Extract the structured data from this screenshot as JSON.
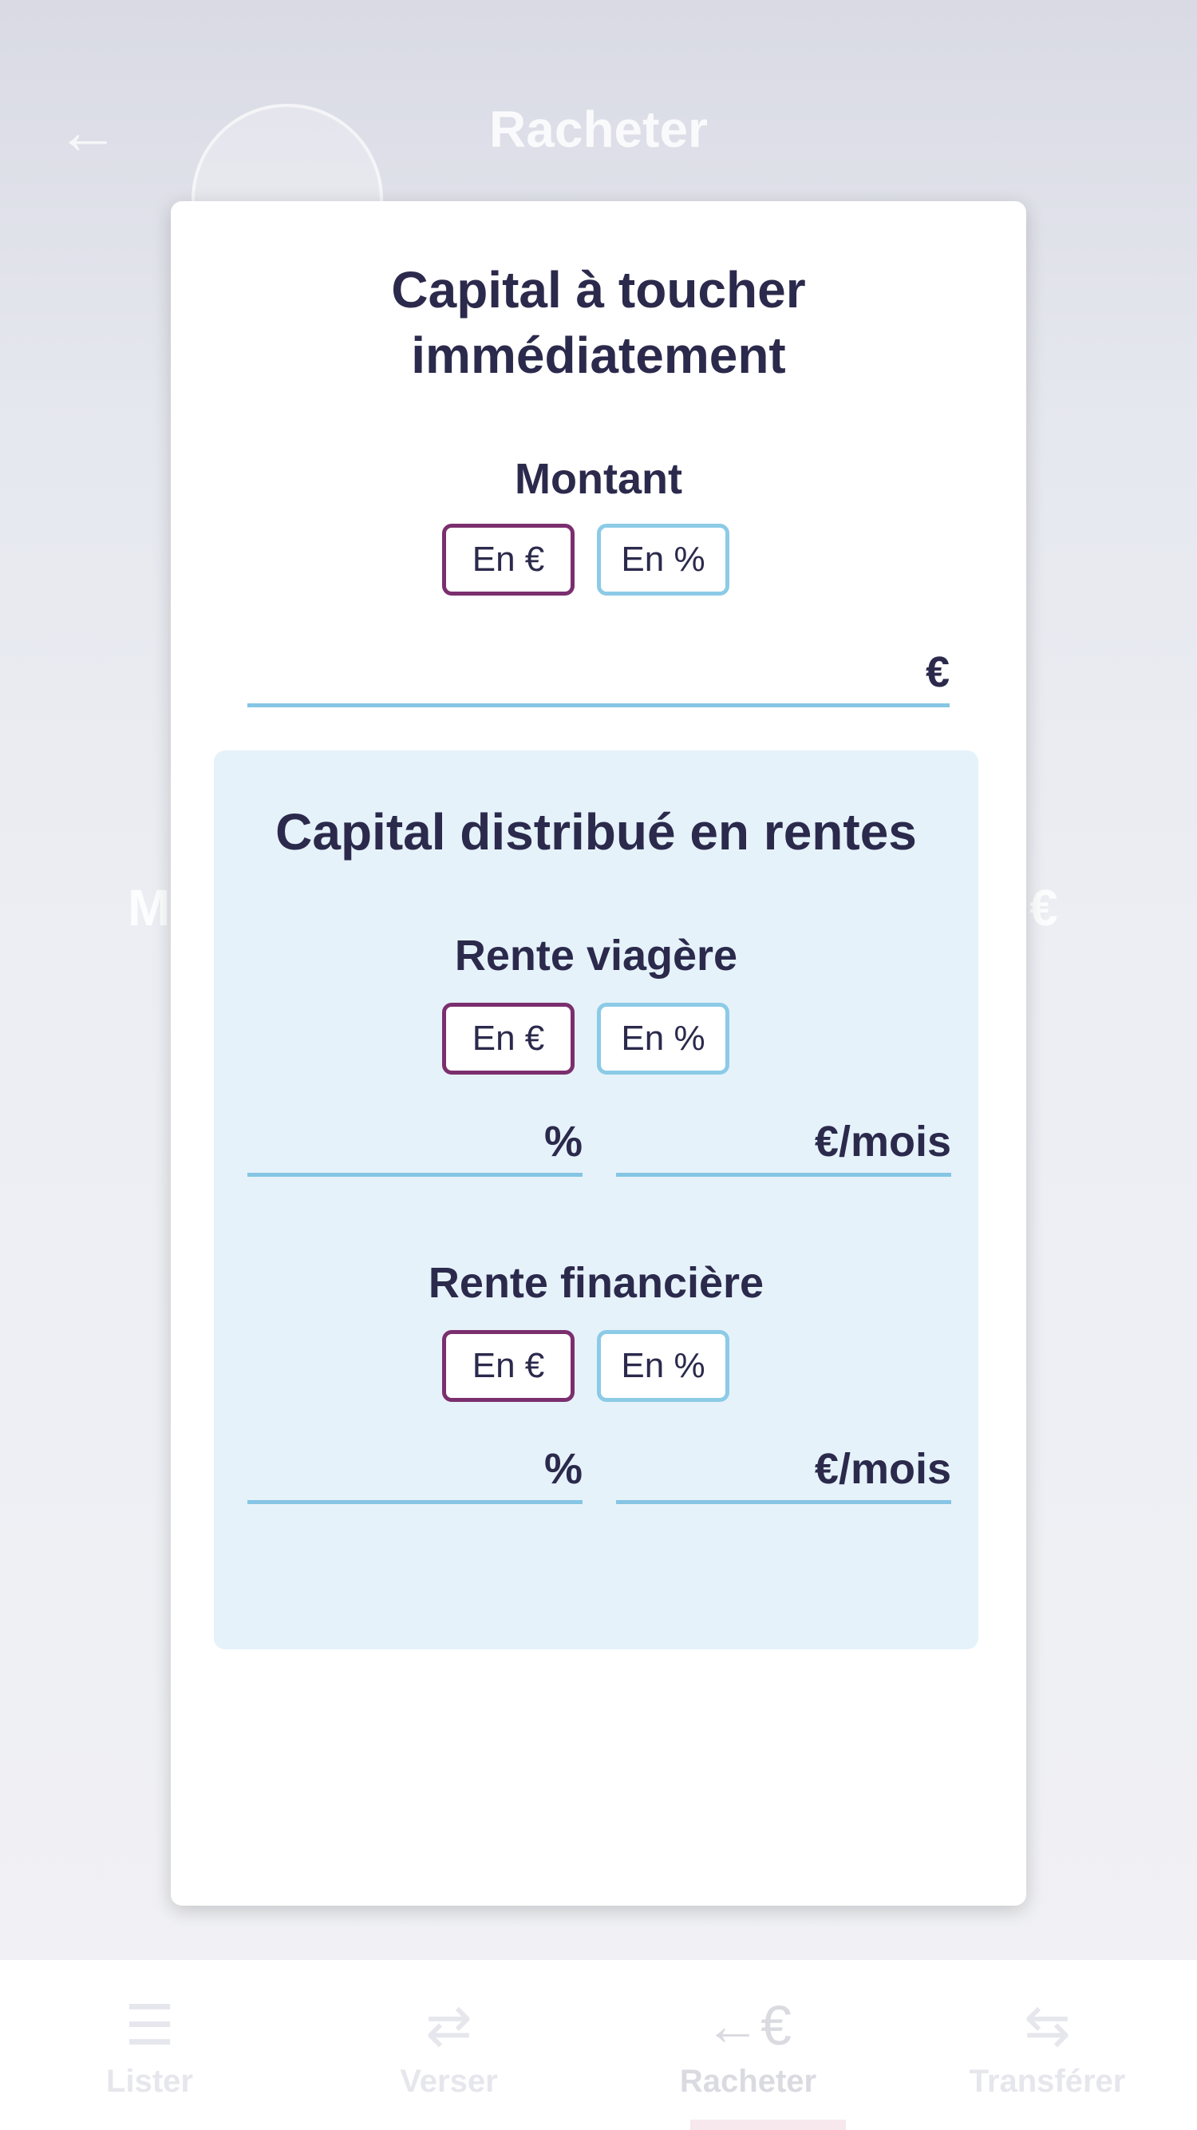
{
  "background": {
    "header_title": "Racheter",
    "side_left": "M",
    "side_right": "€",
    "back_icon": "arrow-left-icon",
    "nav": [
      {
        "label": "Lister",
        "icon": "list-icon",
        "glyph": "☰"
      },
      {
        "label": "Verser",
        "icon": "euro-arrows-icon",
        "glyph": "⇄"
      },
      {
        "label": "Racheter",
        "icon": "euro-back-icon",
        "glyph": "←€"
      },
      {
        "label": "Transférer",
        "icon": "transfer-icon",
        "glyph": "⇆"
      }
    ]
  },
  "modal": {
    "title": "Capital à toucher immédiatement",
    "montant": {
      "label": "Montant",
      "toggle_eur": "En €",
      "toggle_pct": "En %",
      "selected": "eur",
      "value": "",
      "unit": "€"
    },
    "rentes": {
      "title": "Capital distribué en rentes",
      "viagere": {
        "label": "Rente viagère",
        "toggle_eur": "En €",
        "toggle_pct": "En %",
        "selected": "eur",
        "pct_value": "",
        "pct_unit": "%",
        "eur_value": "",
        "eur_unit": "€/mois"
      },
      "financiere": {
        "label": "Rente financière",
        "toggle_eur": "En €",
        "toggle_pct": "En %",
        "selected": "eur",
        "pct_value": "",
        "pct_unit": "%",
        "eur_value": "",
        "eur_unit": "€/mois"
      }
    }
  },
  "colors": {
    "text": "#2b2a4c",
    "selected_border": "#7b2f6e",
    "unselected_border": "#8ccbe6",
    "underline": "#86c5e4",
    "rentes_bg": "#e6f2fa"
  }
}
